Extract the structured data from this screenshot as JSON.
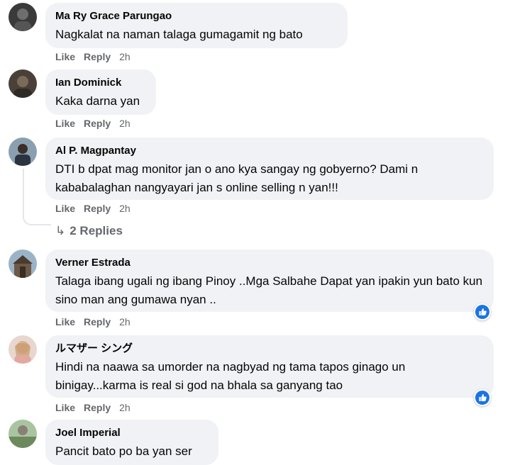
{
  "colors": {
    "bubble": "#f0f2f5",
    "meta": "#65676b",
    "like_blue": "#1b74e4"
  },
  "comments": [
    {
      "author": "Ma Ry Grace Parungao",
      "text": "Nagkalat na naman talaga gumagamit ng bato",
      "like": "Like",
      "reply": "Reply",
      "time": "2h"
    },
    {
      "author": "Ian Dominick",
      "text": "Kaka darna yan",
      "like": "Like",
      "reply": "Reply",
      "time": "2h"
    },
    {
      "author": "Al P. Magpantay",
      "text": "DTI b dpat mag monitor jan o ano kya sangay ng gobyerno? Dami n kababalaghan nangyayari jan s online selling n yan!!!",
      "like": "Like",
      "reply": "Reply",
      "time": "2h",
      "replies": "2 Replies"
    },
    {
      "author": "Verner Estrada",
      "text": "Talaga ibang ugali ng ibang Pinoy ..Mga Salbahe Dapat yan ipakin yun bato kun sino man ang gumawa nyan ..",
      "like": "Like",
      "reply": "Reply",
      "time": "2h",
      "reaction": "like-icon"
    },
    {
      "author": "ルマザー シング",
      "text": "Hindi na naawa sa umorder na nagbyad ng tama tapos ginago un binigay...karma is real si god na bhala sa ganyang tao",
      "like": "Like",
      "reply": "Reply",
      "time": "2h",
      "reaction": "like-icon"
    },
    {
      "author": "Joel Imperial",
      "text": "Pancit bato po ba yan ser"
    }
  ]
}
